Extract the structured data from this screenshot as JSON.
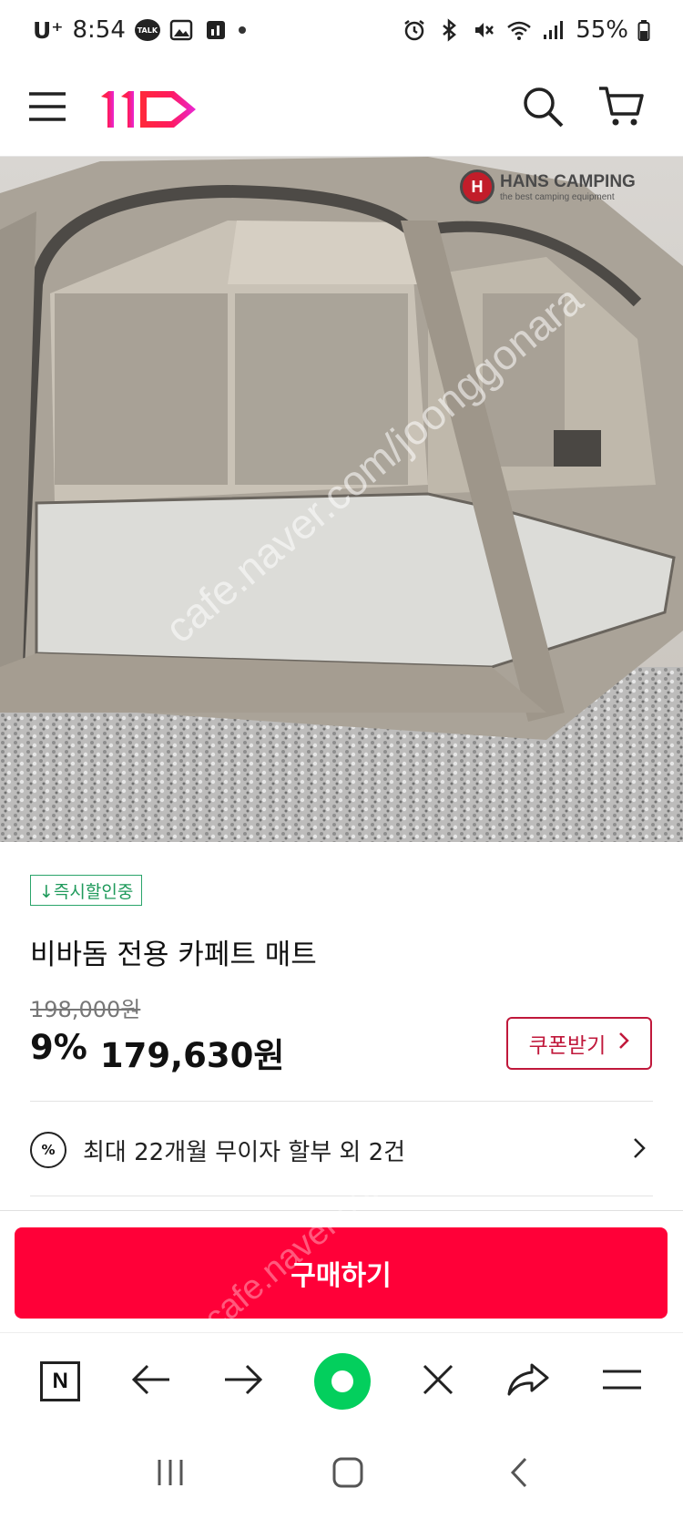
{
  "status_bar": {
    "carrier": "U⁺",
    "time": "8:54",
    "talk_label": "TALK",
    "battery": "55%"
  },
  "header": {
    "logo_text": "11"
  },
  "product_image": {
    "brand_watermark": "HANS CAMPING",
    "brand_tagline": "the best camping equipment",
    "site_watermark": "cafe.naver.com/joonggonara"
  },
  "product": {
    "badge": "↓즉시할인중",
    "title": "비바돔 전용 카페트 매트",
    "original_price": "198,000원",
    "discount": "9%",
    "price": "179,630원",
    "coupon_label": "쿠폰받기"
  },
  "installment": {
    "icon_label": "%",
    "text": "최대 22개월 무이자 할부 외 2건"
  },
  "buy_bar": {
    "buy_label": "구매하기",
    "watermark": "cafe.naver.com"
  },
  "browser_bar": {
    "n_label": "N"
  },
  "colors": {
    "brand_red": "#ff0038",
    "coupon_red": "#c0183b",
    "badge_green": "#1f9a5b",
    "naver_green": "#03cf5d"
  }
}
